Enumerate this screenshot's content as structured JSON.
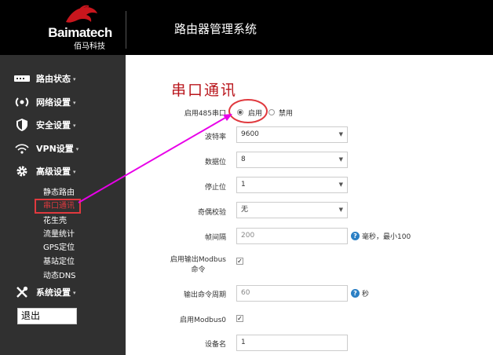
{
  "header": {
    "brand": "Baimatech",
    "brand_sub": "佰马科技",
    "title": "路由器管理系统"
  },
  "sidebar": {
    "menu": [
      {
        "label": "路由状态",
        "icon": "router-status-icon"
      },
      {
        "label": "网络设置",
        "icon": "network-icon"
      },
      {
        "label": "安全设置",
        "icon": "shield-icon"
      },
      {
        "label": "VPN设置",
        "icon": "vpn-wifi-icon"
      },
      {
        "label": "高级设置",
        "icon": "gear-icon"
      }
    ],
    "submenu": [
      "静态路由",
      "串口通讯",
      "花生壳",
      "流量统计",
      "GPS定位",
      "基站定位",
      "动态DNS"
    ],
    "system": {
      "label": "系统设置",
      "icon": "tools-icon"
    },
    "logout": "退出"
  },
  "page": {
    "title": "串口通讯",
    "enable_485": {
      "label": "启用485串口",
      "options": [
        "启用",
        "禁用"
      ],
      "selected": "启用"
    },
    "baud_rate": {
      "label": "波特率",
      "value": "9600"
    },
    "data_bits": {
      "label": "数据位",
      "value": "8"
    },
    "stop_bits": {
      "label": "停止位",
      "value": "1"
    },
    "parity": {
      "label": "奇偶校验",
      "value": "无"
    },
    "frame_interval": {
      "label": "帧间隔",
      "placeholder": "200",
      "hint": "毫秒，最小100"
    },
    "modbus_output": {
      "label_line1": "启用输出Modbus",
      "label_line2": "命令",
      "checked": true
    },
    "output_period": {
      "label": "输出命令周期",
      "placeholder": "60",
      "hint": "秒"
    },
    "modbus0": {
      "label": "启用Modbus0",
      "checked": true
    },
    "device_name": {
      "label": "设备名",
      "value": "1"
    }
  },
  "colors": {
    "accent_red": "#b9161c",
    "annotation_red": "#e0393e",
    "annotation_arrow": "#e800e8",
    "sidebar_bg": "#303030",
    "header_bg": "#000000"
  }
}
